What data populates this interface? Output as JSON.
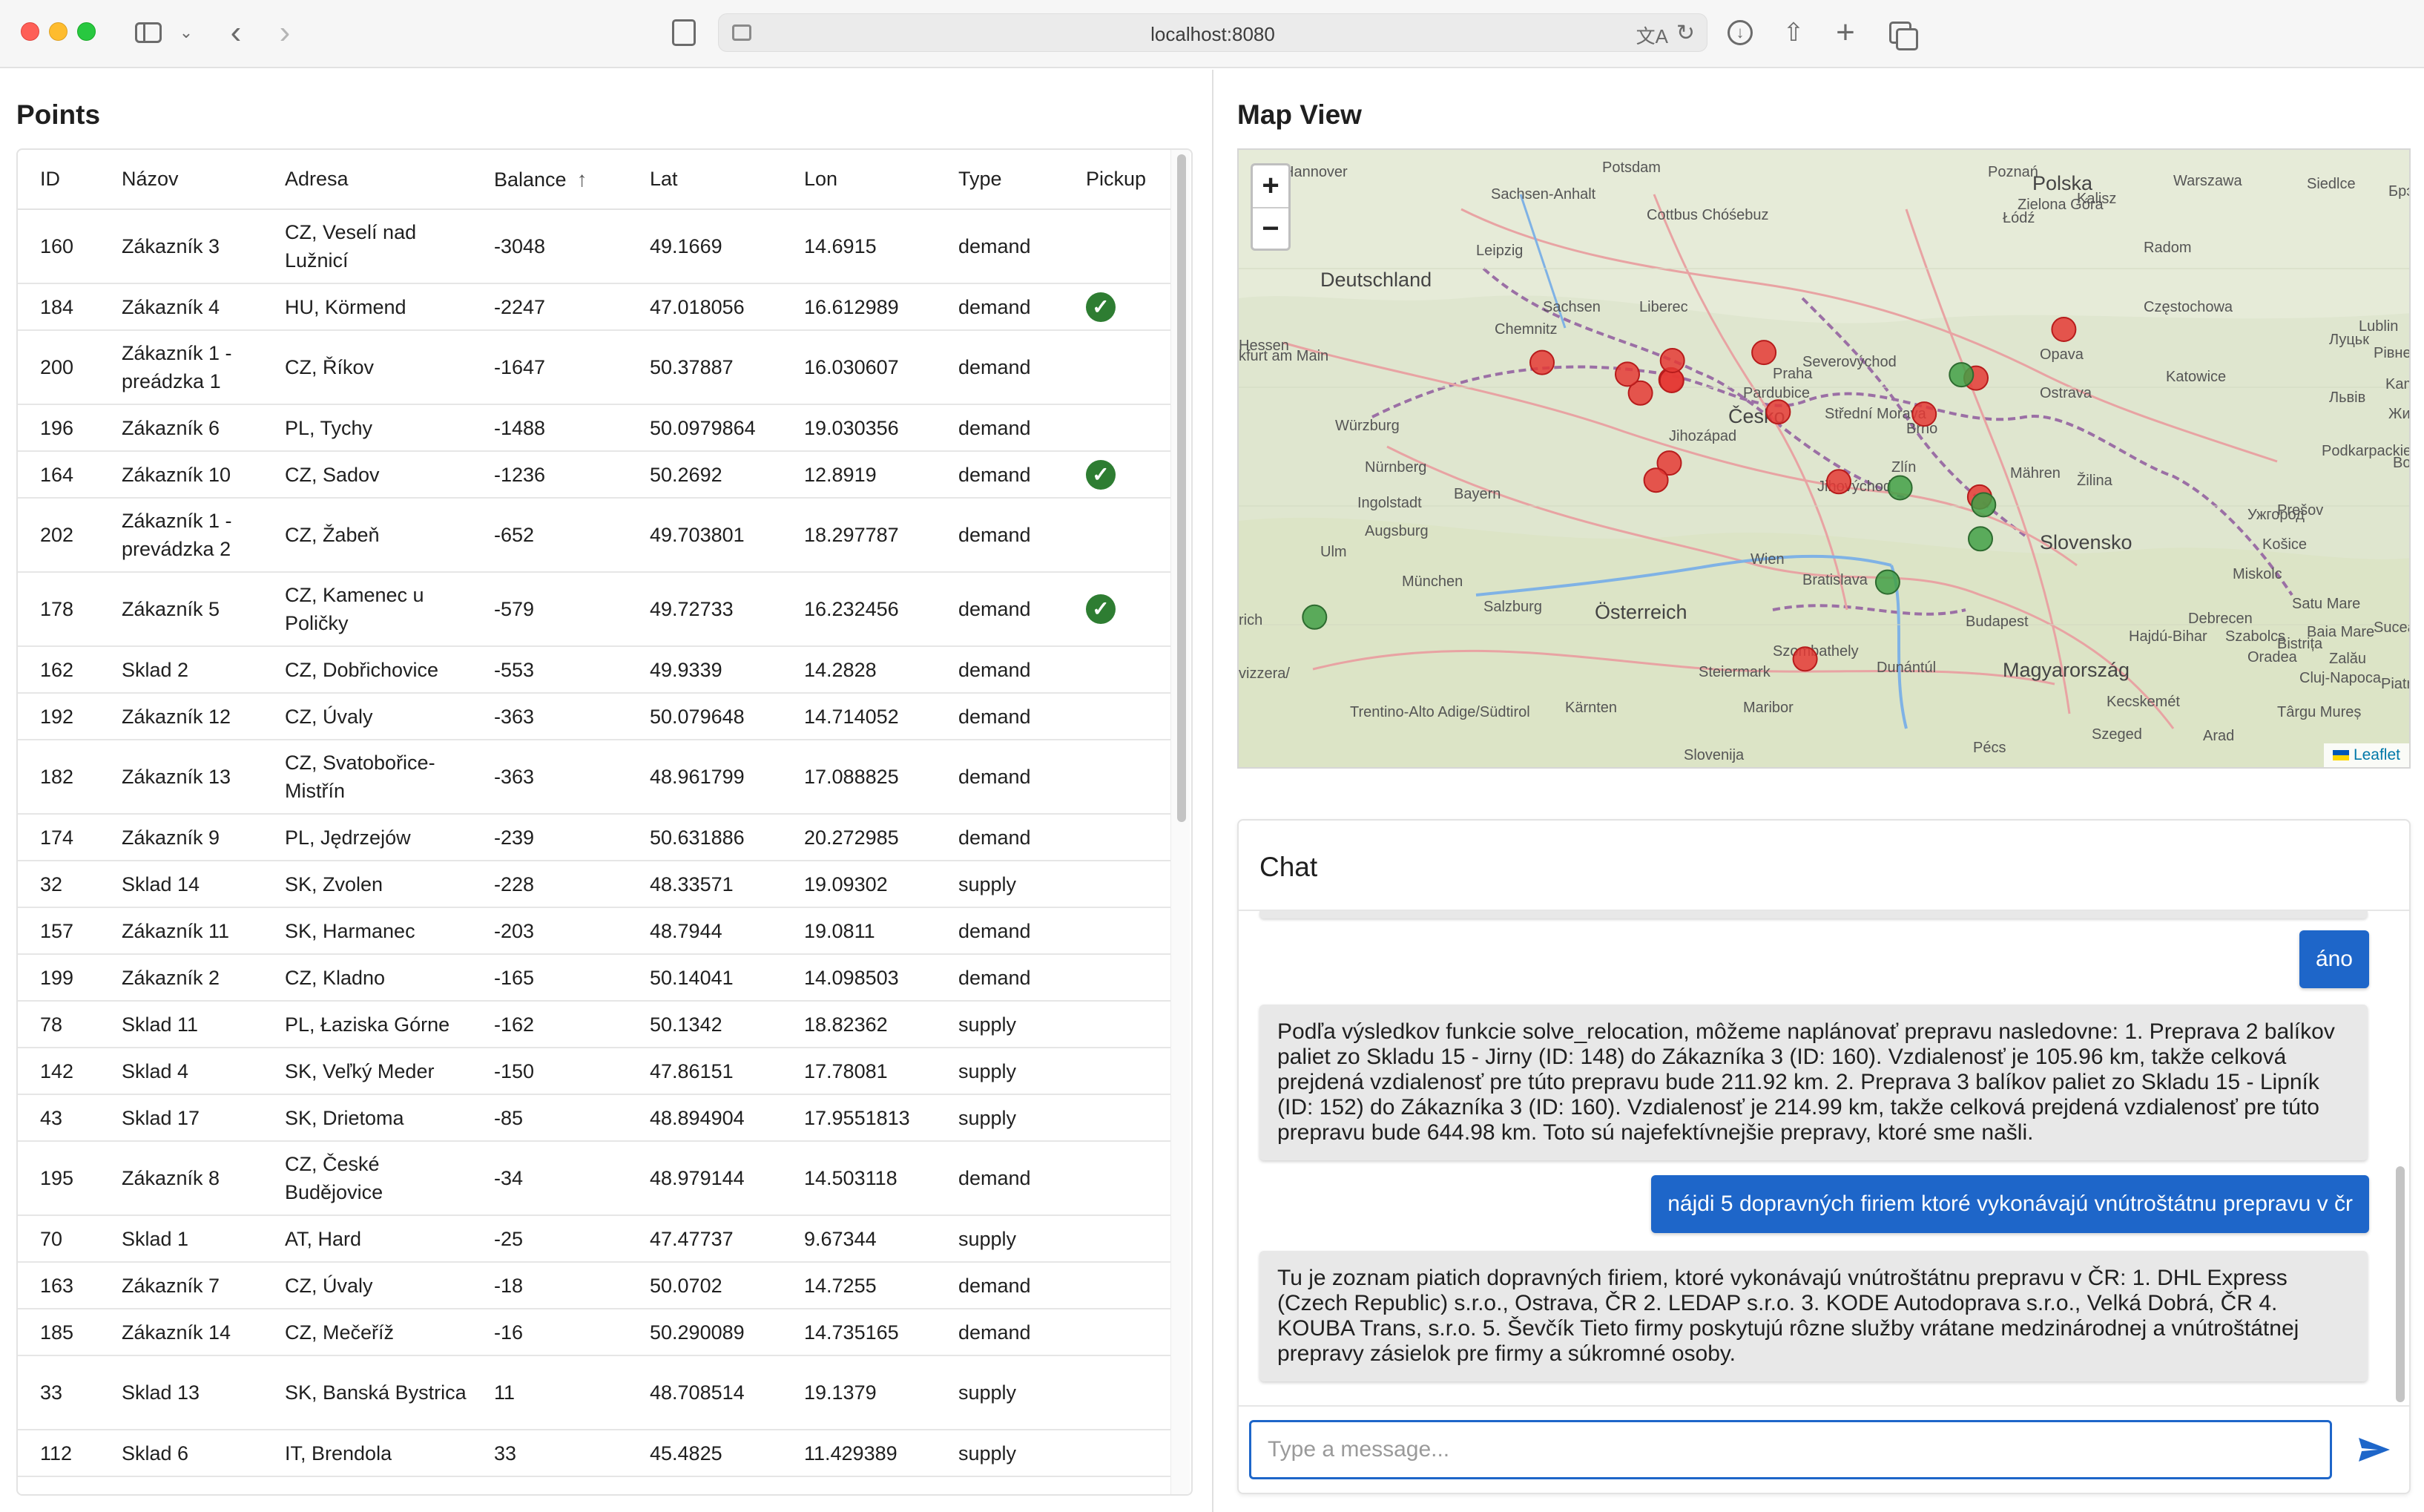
{
  "browser": {
    "url": "localhost:8080",
    "icons": {
      "back": "chevron-left-icon",
      "forward": "chevron-right-icon",
      "sidebar": "sidebar-icon",
      "reader": "reader-icon",
      "translate": "translate-icon",
      "reload": "reload-icon",
      "download": "download-icon",
      "share": "share-icon",
      "new_tab": "plus-icon",
      "tabs": "tab-overview-icon"
    }
  },
  "points": {
    "title": "Points",
    "columns": [
      "ID",
      "Názov",
      "Adresa",
      "Balance",
      "Lat",
      "Lon",
      "Type",
      "Pickup"
    ],
    "sorted_column": "Balance",
    "sort_direction": "ascending",
    "rows": [
      {
        "id": "160",
        "name": "Zákazník 3",
        "address": "CZ, Veselí nad Lužnicí",
        "balance": "-3048",
        "lat": "49.1669",
        "lon": "14.6915",
        "type": "demand",
        "pickup": false
      },
      {
        "id": "184",
        "name": "Zákazník 4",
        "address": "HU, Körmend",
        "balance": "-2247",
        "lat": "47.018056",
        "lon": "16.612989",
        "type": "demand",
        "pickup": true
      },
      {
        "id": "200",
        "name": "Zákazník 1 - preádzka 1",
        "address": "CZ, Říkov",
        "balance": "-1647",
        "lat": "50.37887",
        "lon": "16.030607",
        "type": "demand",
        "pickup": false
      },
      {
        "id": "196",
        "name": "Zákazník 6",
        "address": "PL, Tychy",
        "balance": "-1488",
        "lat": "50.0979864",
        "lon": "19.030356",
        "type": "demand",
        "pickup": false
      },
      {
        "id": "164",
        "name": "Zákazník 10",
        "address": "CZ, Sadov",
        "balance": "-1236",
        "lat": "50.2692",
        "lon": "12.8919",
        "type": "demand",
        "pickup": true
      },
      {
        "id": "202",
        "name": "Zákazník 1 - prevádzka 2",
        "address": "CZ, Žabeň",
        "balance": "-652",
        "lat": "49.703801",
        "lon": "18.297787",
        "type": "demand",
        "pickup": false
      },
      {
        "id": "178",
        "name": "Zákazník 5",
        "address": "CZ, Kamenec u Poličky",
        "balance": "-579",
        "lat": "49.72733",
        "lon": "16.232456",
        "type": "demand",
        "pickup": true
      },
      {
        "id": "162",
        "name": "Sklad 2",
        "address": "CZ, Dobřichovice",
        "balance": "-553",
        "lat": "49.9339",
        "lon": "14.2828",
        "type": "demand",
        "pickup": false
      },
      {
        "id": "192",
        "name": "Zákazník 12",
        "address": "CZ, Úvaly",
        "balance": "-363",
        "lat": "50.079648",
        "lon": "14.714052",
        "type": "demand",
        "pickup": false
      },
      {
        "id": "182",
        "name": "Zákazník 13",
        "address": "CZ, Svatobořice-Mistřín",
        "balance": "-363",
        "lat": "48.961799",
        "lon": "17.088825",
        "type": "demand",
        "pickup": false
      },
      {
        "id": "174",
        "name": "Zákazník 9",
        "address": "PL, Jędrzejów",
        "balance": "-239",
        "lat": "50.631886",
        "lon": "20.272985",
        "type": "demand",
        "pickup": false
      },
      {
        "id": "32",
        "name": "Sklad 14",
        "address": "SK, Zvolen",
        "balance": "-228",
        "lat": "48.33571",
        "lon": "19.09302",
        "type": "supply",
        "pickup": false
      },
      {
        "id": "157",
        "name": "Zákazník 11",
        "address": "SK, Harmanec",
        "balance": "-203",
        "lat": "48.7944",
        "lon": "19.0811",
        "type": "demand",
        "pickup": false
      },
      {
        "id": "199",
        "name": "Zákazník 2",
        "address": "CZ, Kladno",
        "balance": "-165",
        "lat": "50.14041",
        "lon": "14.098503",
        "type": "demand",
        "pickup": false
      },
      {
        "id": "78",
        "name": "Sklad 11",
        "address": "PL, Łaziska Górne",
        "balance": "-162",
        "lat": "50.1342",
        "lon": "18.82362",
        "type": "supply",
        "pickup": false
      },
      {
        "id": "142",
        "name": "Sklad 4",
        "address": "SK, Veľký Meder",
        "balance": "-150",
        "lat": "47.86151",
        "lon": "17.78081",
        "type": "supply",
        "pickup": false
      },
      {
        "id": "43",
        "name": "Sklad 17",
        "address": "SK, Drietoma",
        "balance": "-85",
        "lat": "48.894904",
        "lon": "17.9551813",
        "type": "supply",
        "pickup": false
      },
      {
        "id": "195",
        "name": "Zákazník 8",
        "address": "CZ, České Budějovice",
        "balance": "-34",
        "lat": "48.979144",
        "lon": "14.503118",
        "type": "demand",
        "pickup": false
      },
      {
        "id": "70",
        "name": "Sklad 1",
        "address": "AT, Hard",
        "balance": "-25",
        "lat": "47.47737",
        "lon": "9.67344",
        "type": "supply",
        "pickup": false
      },
      {
        "id": "163",
        "name": "Zákazník 7",
        "address": "CZ, Úvaly",
        "balance": "-18",
        "lat": "50.0702",
        "lon": "14.7255",
        "type": "demand",
        "pickup": false
      },
      {
        "id": "185",
        "name": "Zákazník 14",
        "address": "CZ, Mečeříž",
        "balance": "-16",
        "lat": "50.290089",
        "lon": "14.735165",
        "type": "demand",
        "pickup": false
      },
      {
        "id": "33",
        "name": "Sklad 13",
        "address": "SK, Banská Bystrica",
        "balance": "11",
        "lat": "48.708514",
        "lon": "19.1379",
        "type": "supply",
        "pickup": false
      },
      {
        "id": "112",
        "name": "Sklad 6",
        "address": "IT, Brendola",
        "balance": "33",
        "lat": "45.4825",
        "lon": "11.429389",
        "type": "supply",
        "pickup": false
      }
    ]
  },
  "map": {
    "title": "Map View",
    "zoom_in": "+",
    "zoom_out": "−",
    "attribution": "Leaflet",
    "labels": [
      "Hannover",
      "Potsdam",
      "Poznań",
      "Warszawa",
      "Siedlce",
      "Брэст",
      "Sachsen-Anhalt",
      "Zielona Góra",
      "Kalisz",
      "Polska",
      "Łódź",
      "Radom",
      "Cottbus Chóśebuz",
      "Leipzig",
      "Deutschland",
      "Sachsen",
      "Chemnitz",
      "Liberec",
      "Częstochowa",
      "Katowice",
      "Lublin",
      "Луцьк",
      "Рівне",
      "Hessen",
      "kfurt am Main",
      "Würzburg",
      "Pardubice",
      "Česko",
      "Ostrava",
      "Nürnberg",
      "Zlín",
      "Žilina",
      "Львів",
      "Ingolstadt",
      "Bayern",
      "Augsburg",
      "Ulm",
      "Brno",
      "Prešov",
      "Košice",
      "Ужгород",
      "Wien",
      "Bratislava",
      "Miskolc",
      "München",
      "Salzburg",
      "Österreich",
      "Budapest",
      "Satu Mare",
      "Baia Mare",
      "Debrecen",
      "Szombathely",
      "Magyarország",
      "Oradea",
      "Cluj-Napoca",
      "Bistrița",
      "Kecskemét",
      "Maribor",
      "Szeged",
      "Arad",
      "Pécs",
      "Târgu Mureș",
      "Suceava",
      "Slovensko",
      "Slovenija",
      "Kärnten",
      "Steiermark",
      "Trentino-Alto Adige/Südtirol",
      "rich",
      "vizzera/",
      "Mähren",
      "Severovýchod",
      "Jihovýchod",
      "Jihozápad",
      "Střední Morava",
      "Praha",
      "Szabolcs",
      "Zalău",
      "Piatra N",
      "Kam",
      "Жит",
      "Bot",
      "Dunántúl",
      "Opava",
      "Podkarpackie",
      "Hajdú-Bihar"
    ],
    "marker_colors": {
      "demand": "#e53935",
      "supply": "#43a047"
    },
    "legend_note": ""
  },
  "chat": {
    "title": "Chat",
    "messages": [
      {
        "role": "user",
        "text": "áno"
      },
      {
        "role": "bot",
        "text": "Podľa výsledkov funkcie solve_relocation, môžeme naplánovať prepravu nasledovne: 1. Preprava 2 balíkov paliet zo Skladu 15 - Jirny (ID: 148) do Zákazníka 3 (ID: 160). Vzdialenosť je 105.96 km, takže celková prejdená vzdialenosť pre túto prepravu bude 211.92 km. 2. Preprava 3 balíkov paliet zo Skladu 15 - Lipník (ID: 152) do Zákazníka 3 (ID: 160). Vzdialenosť je 214.99 km, takže celková prejdená vzdialenosť pre túto prepravu bude 644.98 km. Toto sú najefektívnejšie prepravy, ktoré sme našli."
      },
      {
        "role": "user",
        "text": "nájdi 5 dopravných firiem ktoré vykonávajú vnútroštátnu prepravu v čr"
      },
      {
        "role": "bot",
        "text": "Tu je zoznam piatich dopravných firiem, ktoré vykonávajú vnútroštátnu prepravu v ČR: 1. DHL Express (Czech Republic) s.r.o., Ostrava, ČR 2. LEDAP s.r.o. 3. KODE Autodoprava s.r.o., Velká Dobrá, ČR 4. KOUBA Trans, s.r.o. 5. Ševčík Tieto firmy poskytujú rôzne služby vrátane medzinárodnej a vnútroštátnej prepravy zásielok pre firmy a súkromné osoby."
      }
    ],
    "input_value": "",
    "input_placeholder": "Type a message...",
    "send_icon": "send-icon"
  }
}
